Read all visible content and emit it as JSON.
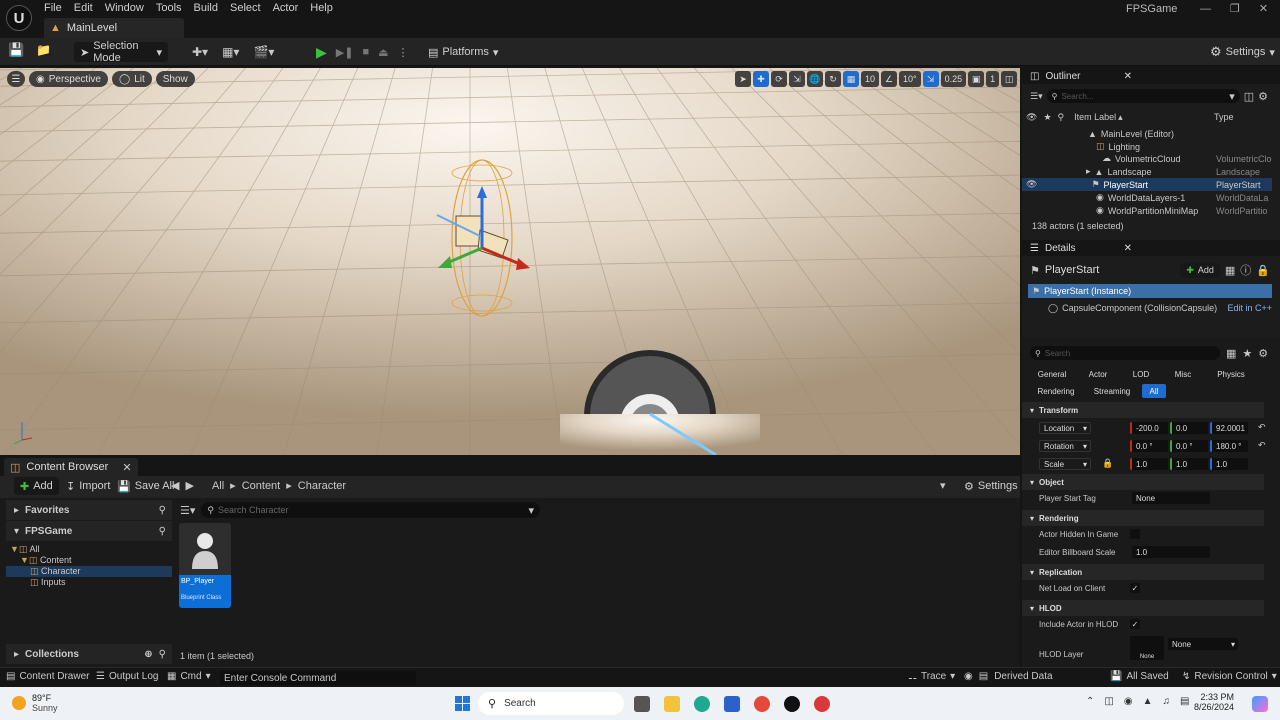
{
  "app": {
    "title": "FPSGame",
    "logo": "U"
  },
  "menu": [
    "File",
    "Edit",
    "Window",
    "Tools",
    "Build",
    "Select",
    "Actor",
    "Help"
  ],
  "level_tab": "MainLevel",
  "toolbar": {
    "mode": "Selection Mode",
    "platforms": "Platforms",
    "settings": "Settings"
  },
  "viewport": {
    "menu_icon": "hamburger-icon",
    "perspective": "Perspective",
    "lit": "Lit",
    "show": "Show",
    "grid_snap": "10",
    "rot_snap": "10°",
    "scale_snap": "0.25",
    "camera_speed": "1"
  },
  "content_browser": {
    "tab": "Content Browser",
    "add": "Add",
    "import": "Import",
    "save_all": "Save All",
    "path": [
      "All",
      "Content",
      "Character"
    ],
    "settings": "Settings",
    "favorites": "Favorites",
    "project": "FPSGame",
    "tree": [
      "All",
      "Content",
      "Character",
      "Inputs"
    ],
    "collections": "Collections",
    "search_placeholder": "Search Character",
    "asset": {
      "name": "BP_Player",
      "type": "Blueprint Class"
    },
    "count": "1 item (1 selected)"
  },
  "outliner": {
    "tab": "Outliner",
    "search_placeholder": "Search...",
    "col_label": "Item Label",
    "col_type": "Type",
    "rows": [
      {
        "label": "MainLevel (Editor)",
        "type": ""
      },
      {
        "label": "Lighting",
        "type": ""
      },
      {
        "label": "VolumetricCloud",
        "type": "VolumetricClo"
      },
      {
        "label": "Landscape",
        "type": "Landscape"
      },
      {
        "label": "PlayerStart",
        "type": "PlayerStart"
      },
      {
        "label": "WorldDataLayers-1",
        "type": "WorldDataLa"
      },
      {
        "label": "WorldPartitionMiniMap",
        "type": "WorldPartitio"
      }
    ],
    "footer": "138 actors (1 selected)"
  },
  "details": {
    "tab": "Details",
    "actor": "PlayerStart",
    "add": "Add",
    "instance": "PlayerStart (Instance)",
    "component": "CapsuleComponent (CollisionCapsule)",
    "edit_cpp": "Edit in C++",
    "search_placeholder": "Search",
    "filters1": [
      "General",
      "Actor",
      "LOD",
      "Misc",
      "Physics"
    ],
    "filters2": [
      "Rendering",
      "Streaming",
      "All"
    ],
    "transform": "Transform",
    "location": {
      "label": "Location",
      "x": "-200.0",
      "y": "0.0",
      "z": "92.0001"
    },
    "rotation": {
      "label": "Rotation",
      "x": "0.0 °",
      "y": "0.0 °",
      "z": "180.0 °"
    },
    "scale": {
      "label": "Scale",
      "x": "1.0",
      "y": "1.0",
      "z": "1.0"
    },
    "object": "Object",
    "player_start_tag": "Player Start Tag",
    "tag_value": "None",
    "rendering": "Rendering",
    "hidden": "Actor Hidden In Game",
    "billboard": "Editor Billboard Scale",
    "billboard_value": "1.0",
    "replication": "Replication",
    "net_load": "Net Load on Client",
    "hlod": "HLOD",
    "include_hlod": "Include Actor in HLOD",
    "hlod_layer": "HLOD Layer",
    "hlod_value": "None",
    "hlod_thumb": "None"
  },
  "statusbar": {
    "drawer": "Content Drawer",
    "output": "Output Log",
    "cmd": "Cmd",
    "console_placeholder": "Enter Console Command",
    "trace": "Trace",
    "derived": "Derived Data",
    "saved": "All Saved",
    "revision": "Revision Control"
  },
  "taskbar": {
    "temp": "89°F",
    "weather": "Sunny",
    "search": "Search",
    "time": "2:33 PM",
    "date": "8/26/2024"
  }
}
